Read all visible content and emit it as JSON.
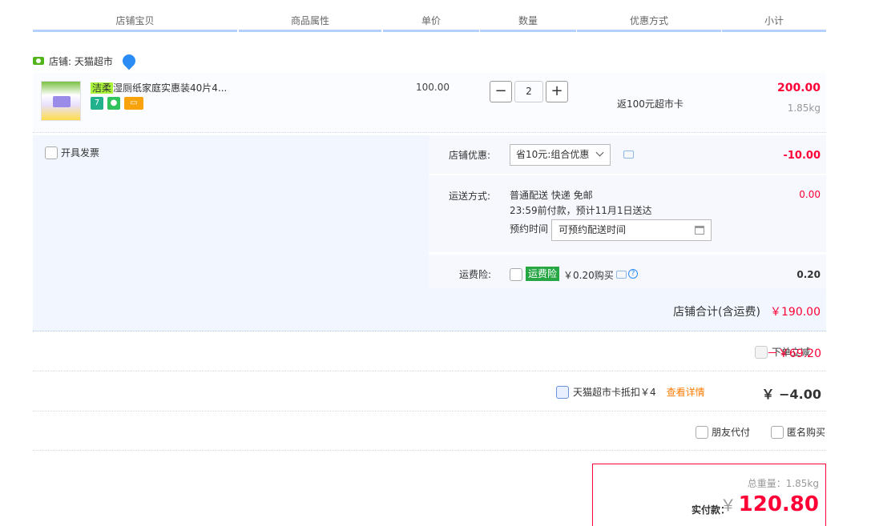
{
  "header": {
    "columns": [
      "店铺宝贝",
      "商品属性",
      "单价",
      "数量",
      "优惠方式",
      "小计"
    ]
  },
  "shop": {
    "label": "店铺: 天猫超市",
    "icon": "shop-badge-icon"
  },
  "item": {
    "highlight": "洁柔",
    "title": "湿厕纸家庭实惠装40片4...",
    "unit_price": "100.00",
    "quantity": "2",
    "minus": "−",
    "plus": "+",
    "promo": "返100元超市卡",
    "subtotal": "200.00",
    "weight": "1.85kg"
  },
  "options": {
    "invoice_label": "开具发票",
    "shop_discount_label": "店铺优惠:",
    "shop_discount_value": "省10元:组合优惠",
    "shop_discount_amount": "-10.00",
    "delivery_label": "运送方式:",
    "delivery_line1": "普通配送 快递 免邮",
    "delivery_line2": "23:59前付款，预计11月1日送达",
    "schedule_label": "预约时间",
    "schedule_placeholder": "可预约配送时间",
    "delivery_amount": "0.00",
    "insurance_label": "运费险:",
    "insurance_badge": "运费险",
    "insurance_price": "￥0.20购买",
    "insurance_amount": "0.20",
    "shop_total_label": "店铺合计(含运费)",
    "shop_total_amount": "￥190.00"
  },
  "summary": {
    "instant_discount_label": "下单立减",
    "instant_discount_amount": "－￥69.20",
    "card_label": "天猫超市卡抵扣￥4",
    "card_detail_link": "查看详情",
    "card_amount": "￥ −4.00",
    "friend_pay": "朋友代付",
    "anonymous": "匿名购买",
    "total_weight": "总重量：1.85kg",
    "pay_label": "实付款：",
    "currency": "￥",
    "pay_amount": "120.80"
  },
  "colors": {
    "accent": "#ff0036",
    "header_line": "#b2d1ff",
    "panel_bg": "#f2f7ff"
  }
}
